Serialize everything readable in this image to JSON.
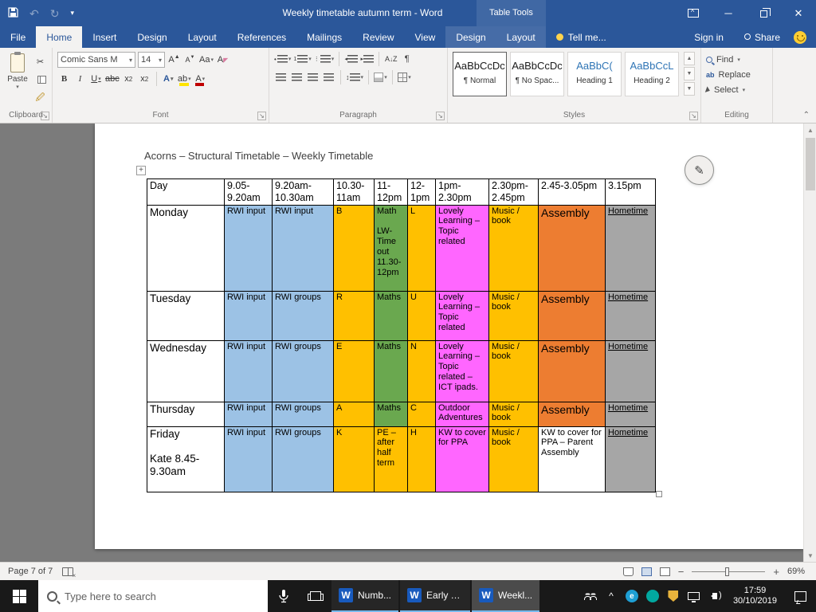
{
  "palette": {
    "white": "#ffffff",
    "blue": "#9cc2e5",
    "gold": "#ffc000",
    "green": "#6aa84f",
    "magenta": "#ff66ff",
    "orange": "#ed7d31",
    "gray": "#a6a6a6"
  },
  "title_bar": {
    "title": "Weekly timetable autumn term - Word",
    "context_group": "Table Tools"
  },
  "tabs": {
    "file": "File",
    "main": [
      "Home",
      "Insert",
      "Design",
      "Layout",
      "References",
      "Mailings",
      "Review",
      "View"
    ],
    "active": "Home",
    "contextual": [
      "Design",
      "Layout"
    ],
    "tell_me": "Tell me...",
    "sign_in": "Sign in",
    "share": "Share"
  },
  "ribbon": {
    "paste": "Paste",
    "font_name": "Comic Sans M",
    "font_size": "14",
    "groups": {
      "clipboard": "Clipboard",
      "font": "Font",
      "paragraph": "Paragraph",
      "styles": "Styles",
      "editing": "Editing"
    },
    "styles": [
      {
        "preview": "AaBbCcDc",
        "name": "¶ Normal"
      },
      {
        "preview": "AaBbCcDc",
        "name": "¶ No Spac..."
      },
      {
        "preview": "AaBbC(",
        "name": "Heading 1"
      },
      {
        "preview": "AaBbCcL",
        "name": "Heading 2"
      }
    ],
    "editing": {
      "find": "Find",
      "replace": "Replace",
      "select": "Select"
    }
  },
  "document": {
    "heading": "Acorns – Structural Timetable – Weekly Timetable",
    "table": {
      "columns": [
        "Day",
        "9.05-9.20am",
        "9.20am-10.30am",
        "10.30-11am",
        "11-12pm",
        "12-1pm",
        "1pm-2.30pm",
        "2.30pm-2.45pm",
        "2.45-3.05pm",
        "3.15pm"
      ],
      "rows": [
        {
          "cells": [
            {
              "text": "Monday",
              "color": "white"
            },
            {
              "text": "RWI input",
              "color": "blue"
            },
            {
              "text": "RWI input",
              "color": "blue"
            },
            {
              "text": "B",
              "color": "gold"
            },
            {
              "text": "Math\n\nLW- Time out 11.30-12pm",
              "color": "green"
            },
            {
              "text": "L",
              "color": "gold"
            },
            {
              "text": "Lovely Learning – Topic related",
              "color": "magenta"
            },
            {
              "text": "Music / book",
              "color": "gold"
            },
            {
              "text": "Assembly",
              "color": "orange",
              "large": true
            },
            {
              "text": "Hometime",
              "color": "gray",
              "underline": true
            }
          ]
        },
        {
          "cells": [
            {
              "text": "Tuesday",
              "color": "white"
            },
            {
              "text": "RWI input",
              "color": "blue"
            },
            {
              "text": "RWI groups",
              "color": "blue"
            },
            {
              "text": "R",
              "color": "gold"
            },
            {
              "text": "Maths",
              "color": "green"
            },
            {
              "text": "U",
              "color": "gold"
            },
            {
              "text": "Lovely Learning – Topic related",
              "color": "magenta"
            },
            {
              "text": "Music / book",
              "color": "gold"
            },
            {
              "text": "Assembly",
              "color": "orange",
              "large": true
            },
            {
              "text": "Hometime",
              "color": "gray",
              "underline": true
            }
          ]
        },
        {
          "cells": [
            {
              "text": "Wednesday",
              "color": "white"
            },
            {
              "text": "RWI input",
              "color": "blue"
            },
            {
              "text": "RWI groups",
              "color": "blue"
            },
            {
              "text": "E",
              "color": "gold"
            },
            {
              "text": "Maths",
              "color": "green"
            },
            {
              "text": "N",
              "color": "gold"
            },
            {
              "text": "Lovely Learning – Topic related – ICT ipads.",
              "color": "magenta"
            },
            {
              "text": "Music / book",
              "color": "gold"
            },
            {
              "text": "Assembly",
              "color": "orange",
              "large": true
            },
            {
              "text": "Hometime",
              "color": "gray",
              "underline": true
            }
          ]
        },
        {
          "cells": [
            {
              "text": "Thursday",
              "color": "white"
            },
            {
              "text": "RWI input",
              "color": "blue"
            },
            {
              "text": "RWI groups",
              "color": "blue"
            },
            {
              "text": "A",
              "color": "gold"
            },
            {
              "text": "Maths",
              "color": "green"
            },
            {
              "text": "C",
              "color": "gold"
            },
            {
              "text": "Outdoor Adventures",
              "color": "magenta"
            },
            {
              "text": "Music / book",
              "color": "gold"
            },
            {
              "text": "Assembly",
              "color": "orange",
              "large": true
            },
            {
              "text": "Hometime",
              "color": "gray",
              "underline": true
            }
          ]
        },
        {
          "cells": [
            {
              "text": "Friday\n\nKate 8.45-9.30am",
              "color": "white"
            },
            {
              "text": "RWI input",
              "color": "blue"
            },
            {
              "text": "RWI groups",
              "color": "blue"
            },
            {
              "text": "K",
              "color": "gold"
            },
            {
              "text": "PE – after half term",
              "color": "gold"
            },
            {
              "text": "H",
              "color": "gold"
            },
            {
              "text": "KW to cover for PPA",
              "color": "magenta"
            },
            {
              "text": "Music / book",
              "color": "gold"
            },
            {
              "text": "KW to cover for PPA – Parent Assembly",
              "color": "white"
            },
            {
              "text": "Hometime",
              "color": "gray",
              "underline": true
            }
          ]
        }
      ]
    }
  },
  "status_bar": {
    "page": "Page 7 of 7",
    "zoom": "69%"
  },
  "taskbar": {
    "search_placeholder": "Type here to search",
    "windows": [
      {
        "label": "Numb...",
        "active": false
      },
      {
        "label": "Early Y...",
        "active": false
      },
      {
        "label": "Weekl...",
        "active": true
      }
    ],
    "time": "17:59",
    "date": "30/10/2019"
  }
}
